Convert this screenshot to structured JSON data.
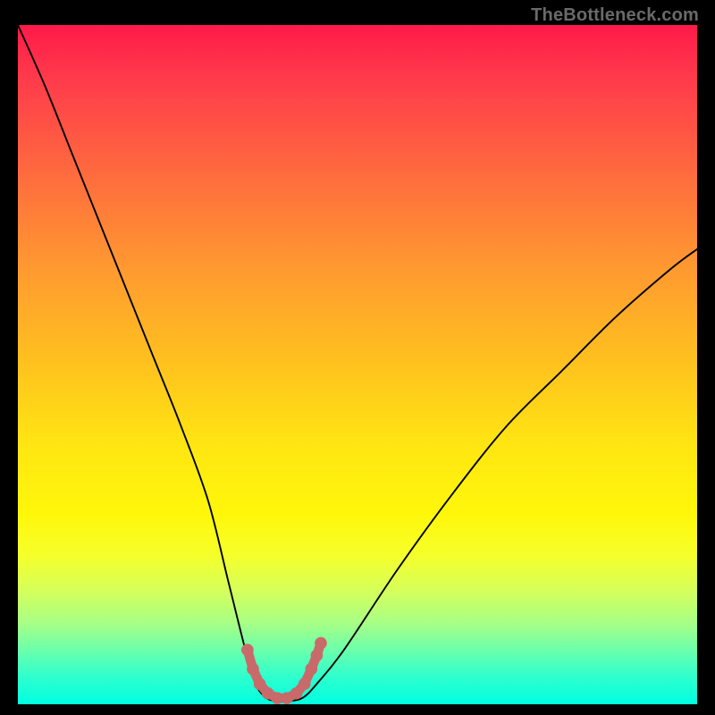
{
  "watermark": {
    "text": "TheBottleneck.com"
  },
  "accent": {
    "marker_color": "#c96a6a",
    "curve_color": "#000000"
  },
  "chart_data": {
    "type": "line",
    "title": "",
    "xlabel": "",
    "ylabel": "",
    "xlim": [
      0,
      100
    ],
    "ylim": [
      0,
      100
    ],
    "grid": false,
    "legend": false,
    "series": [
      {
        "name": "bottleneck-curve",
        "x": [
          0,
          4,
          8,
          12,
          16,
          20,
          24,
          28,
          31,
          33.5,
          35,
          36.5,
          38,
          40,
          42,
          44,
          48,
          56,
          64,
          72,
          80,
          88,
          96,
          100
        ],
        "y": [
          100,
          91,
          81,
          71,
          61,
          51,
          41,
          30,
          18,
          8,
          3,
          1,
          0.5,
          0.5,
          1,
          3,
          8,
          20,
          31,
          41,
          49,
          57,
          64,
          67
        ]
      },
      {
        "name": "optimal-range-markers",
        "x": [
          33.8,
          34.6,
          35.6,
          36.8,
          38.2,
          39.6,
          41.0,
          42.2,
          43.2,
          44.0,
          44.6
        ],
        "y": [
          8.0,
          5.2,
          3.0,
          1.6,
          0.9,
          0.9,
          1.6,
          3.0,
          5.2,
          7.2,
          9.0
        ]
      }
    ]
  }
}
